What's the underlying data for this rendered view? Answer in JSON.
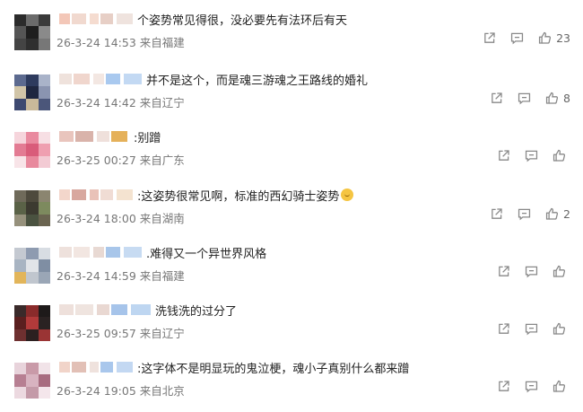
{
  "comments": [
    {
      "text": "个姿势常见得很，没必要先有法环后有天",
      "time": "26-3-24 14:53",
      "location": "来自福建",
      "likes": "23",
      "avatar": [
        "#2b2b2b",
        "#6b6b6b",
        "#3a3a3a",
        "#555",
        "#1e1e1e",
        "#8a8a8a",
        "#444",
        "#2f2f2f",
        "#777"
      ],
      "blur": [
        "#f3c7b8",
        "#f1d9cf",
        "#f5dcd0",
        "#e7cfc6",
        "#efe3de"
      ]
    },
    {
      "text": "并不是这个，而是魂三游魂之王路线的婚礼",
      "time": "26-3-24 14:42",
      "location": "来自辽宁",
      "likes": "8",
      "avatar": [
        "#5c6a8f",
        "#2e3b5e",
        "#a9b3c9",
        "#d1c5a8",
        "#1f2740",
        "#8a94b0",
        "#3d4970",
        "#c9b99a",
        "#4b567a"
      ],
      "blur": [
        "#efe2dc",
        "#f0d6cd",
        "#f3e7e2",
        "#a9c9ef",
        "#c3d9f3"
      ]
    },
    {
      "text": ":别蹭",
      "time": "26-3-25 00:27",
      "location": "来自广东",
      "likes": "",
      "avatar": [
        "#f6d5dc",
        "#e98a9f",
        "#f7dfe4",
        "#e37b93",
        "#d95c7a",
        "#ef9fb0",
        "#f8e4e8",
        "#e8899d",
        "#f3cbd4"
      ],
      "blur": [
        "#e9c5bd",
        "#d9b3aa",
        "#efe0db",
        "#e5b15a"
      ]
    },
    {
      "text": ":这姿势很常见啊，标准的西幻骑士姿势",
      "time": "26-3-24 18:00",
      "location": "来自湖南",
      "likes": "2",
      "avatar": [
        "#6f6a5a",
        "#4e4a3d",
        "#8b8570",
        "#5a6247",
        "#3c3a30",
        "#7d8a5e",
        "#96917c",
        "#4a5240",
        "#6a6450"
      ],
      "blur": [
        "#f3d6cb",
        "#d8a89f",
        "#e9c2b8",
        "#f0dcd4",
        "#f4e3d0"
      ],
      "emoji": true
    },
    {
      "text": ".难得又一个异世界风格",
      "time": "26-3-24 14:59",
      "location": "来自福建",
      "likes": "",
      "avatar": [
        "#c4c9d1",
        "#8e9bb0",
        "#d8dde3",
        "#a8b4c2",
        "#e1e4e8",
        "#7f8ea3",
        "#e2b55a",
        "#c0c6ce",
        "#9aa6b6"
      ],
      "blur": [
        "#eee1dc",
        "#f2e6e1",
        "#e8d9d3",
        "#a8c6ea",
        "#c7dbf2"
      ]
    },
    {
      "text": "洗钱洗的过分了",
      "time": "26-3-25 09:57",
      "location": "来自辽宁",
      "likes": "",
      "avatar": [
        "#3a2a2a",
        "#8a2b2b",
        "#1e1a1a",
        "#5a1f1f",
        "#b23a3a",
        "#2a2222",
        "#6e3030",
        "#2c2020",
        "#9a3434"
      ],
      "blur": [
        "#eee0db",
        "#efe4df",
        "#e9d8d2",
        "#a6c4ea",
        "#bed6f1"
      ]
    },
    {
      "text": ":这字体不是明显玩的鬼泣梗，魂小子真别什么都来蹭",
      "time": "26-3-24 19:05",
      "location": "来自北京",
      "likes": "",
      "avatar": [
        "#e8d3db",
        "#c99aa8",
        "#f1e3e8",
        "#b77f92",
        "#d8b3c0",
        "#a86c80",
        "#ecd9e0",
        "#c49aa8",
        "#f4e6eb"
      ],
      "blur": [
        "#f1d4c9",
        "#e2c0b6",
        "#efe2dd",
        "#a9c7ec",
        "#c3d8f2"
      ]
    }
  ]
}
